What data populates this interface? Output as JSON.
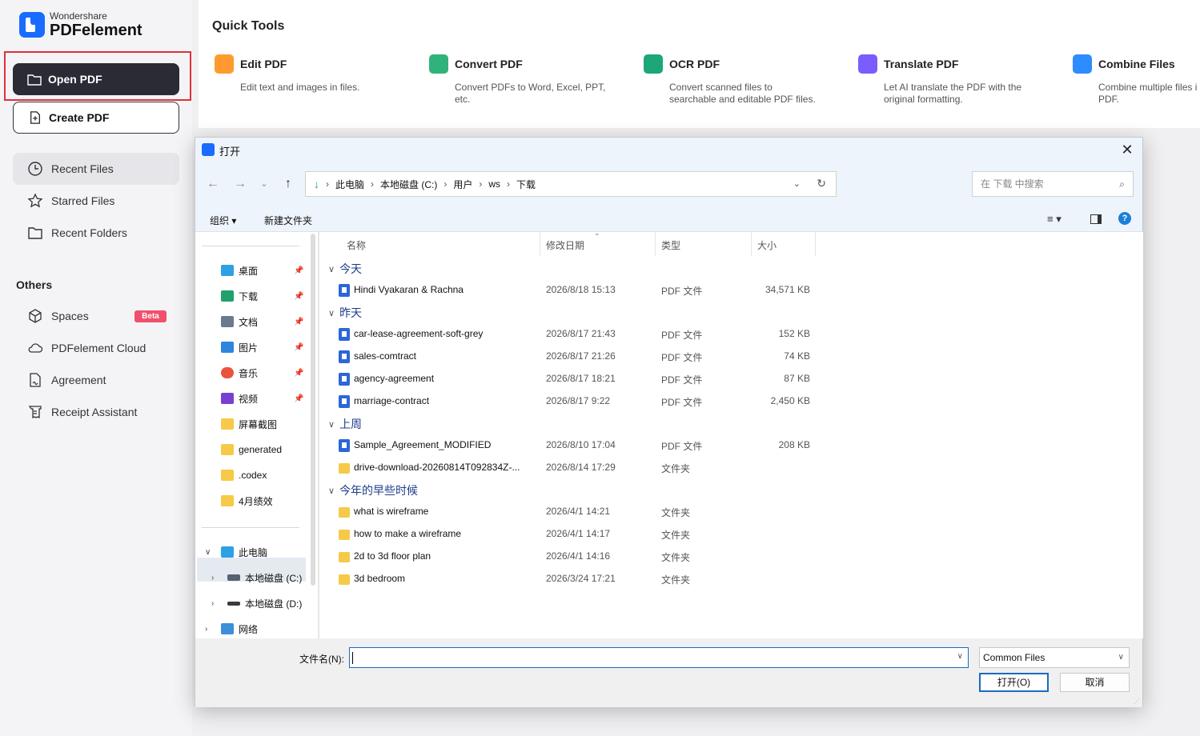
{
  "app": {
    "company": "Wondershare",
    "product": "PDFelement",
    "open_pdf": "Open PDF",
    "create_pdf": "Create PDF",
    "nav": [
      "Recent Files",
      "Starred Files",
      "Recent Folders"
    ],
    "others_title": "Others",
    "others": [
      "Spaces",
      "PDFelement Cloud",
      "Agreement",
      "Receipt Assistant"
    ],
    "beta_badge": "Beta",
    "colors": {
      "accent": "#1a6bff",
      "dark_button": "#2a2b35",
      "highlight": "#e0303a",
      "beta": "#f0506e"
    }
  },
  "quick_tools": {
    "title": "Quick Tools",
    "tools": [
      {
        "name": "Edit PDF",
        "desc": "Edit text and images in files.",
        "icon": "edit-pdf-icon",
        "color": "#ff9a2e"
      },
      {
        "name": "Convert PDF",
        "desc": "Convert PDFs to Word, Excel, PPT, etc.",
        "icon": "convert-pdf-icon",
        "color": "#2fb37a"
      },
      {
        "name": "OCR PDF",
        "desc": "Convert scanned files to searchable and editable PDF files.",
        "icon": "ocr-pdf-icon",
        "color": "#1ca67a"
      },
      {
        "name": "Translate PDF",
        "desc": "Let AI translate the PDF with the original formatting.",
        "icon": "translate-pdf-icon",
        "color": "#7b5cff"
      },
      {
        "name": "Combine Files",
        "desc": "Combine multiple files i PDF.",
        "icon": "combine-files-icon",
        "color": "#2d8cff"
      }
    ]
  },
  "dialog": {
    "title": "打开",
    "breadcrumb": [
      "此电脑",
      "本地磁盘 (C:)",
      "用户",
      "ws",
      "下载"
    ],
    "search_placeholder": "在 下载 中搜索",
    "toolbar": {
      "organize": "组织 ▾",
      "new_folder": "新建文件夹"
    },
    "tree": {
      "quick": [
        {
          "label": "桌面",
          "color": "#2ea0e6"
        },
        {
          "label": "下载",
          "color": "#22a06b"
        },
        {
          "label": "文档",
          "color": "#6b7a8f"
        },
        {
          "label": "图片",
          "color": "#2e86de"
        },
        {
          "label": "音乐",
          "color": "#e8553e"
        },
        {
          "label": "视频",
          "color": "#7a3fd1"
        },
        {
          "label": "屏幕截图",
          "color": "#f7c948"
        },
        {
          "label": "generated",
          "color": "#f7c948"
        },
        {
          "label": ".codex",
          "color": "#f7c948"
        },
        {
          "label": "4月绩效",
          "color": "#f7c948"
        }
      ],
      "this_pc": "此电脑",
      "drive_c": "本地磁盘 (C:)",
      "drive_d": "本地磁盘 (D:)",
      "network": "网络"
    },
    "columns": {
      "name": "名称",
      "date": "修改日期",
      "type": "类型",
      "size": "大小"
    },
    "groups": [
      {
        "label": "今天",
        "files": [
          {
            "name": "Hindi Vyakaran & Rachna",
            "date": "2026/8/18 15:13",
            "type": "PDF 文件",
            "size": "34,571 KB",
            "kind": "pdf"
          }
        ]
      },
      {
        "label": "昨天",
        "files": [
          {
            "name": "car-lease-agreement-soft-grey",
            "date": "2026/8/17 21:43",
            "type": "PDF 文件",
            "size": "152 KB",
            "kind": "pdf"
          },
          {
            "name": "sales-comtract",
            "date": "2026/8/17 21:26",
            "type": "PDF 文件",
            "size": "74 KB",
            "kind": "pdf"
          },
          {
            "name": "agency-agreement",
            "date": "2026/8/17 18:21",
            "type": "PDF 文件",
            "size": "87 KB",
            "kind": "pdf"
          },
          {
            "name": "marriage-contract",
            "date": "2026/8/17 9:22",
            "type": "PDF 文件",
            "size": "2,450 KB",
            "kind": "pdf"
          }
        ]
      },
      {
        "label": "上周",
        "files": [
          {
            "name": "Sample_Agreement_MODIFIED",
            "date": "2026/8/10 17:04",
            "type": "PDF 文件",
            "size": "208 KB",
            "kind": "pdf"
          },
          {
            "name": "drive-download-20260814T092834Z-...",
            "date": "2026/8/14 17:29",
            "type": "文件夹",
            "size": "",
            "kind": "folder"
          }
        ]
      },
      {
        "label": "今年的早些时候",
        "files": [
          {
            "name": "what is wireframe",
            "date": "2026/4/1 14:21",
            "type": "文件夹",
            "size": "",
            "kind": "folder"
          },
          {
            "name": "how to make a wireframe",
            "date": "2026/4/1 14:17",
            "type": "文件夹",
            "size": "",
            "kind": "folder"
          },
          {
            "name": "2d to 3d floor plan",
            "date": "2026/4/1 14:16",
            "type": "文件夹",
            "size": "",
            "kind": "folder"
          },
          {
            "name": "3d bedroom",
            "date": "2026/3/24 17:21",
            "type": "文件夹",
            "size": "",
            "kind": "folder"
          }
        ]
      }
    ],
    "filename_label": "文件名(N):",
    "filename_value": "",
    "file_type": "Common Files",
    "open_button": "打开(O)",
    "cancel_button": "取消"
  }
}
